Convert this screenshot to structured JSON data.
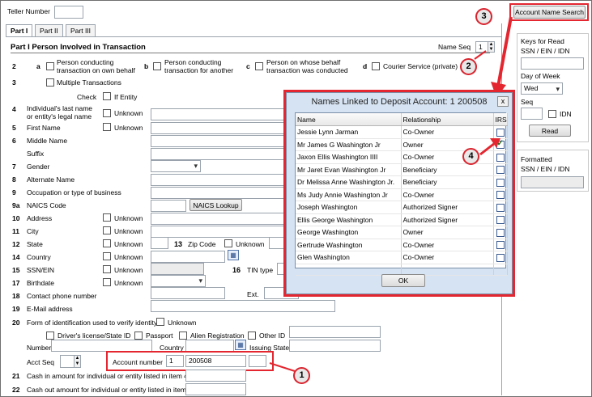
{
  "header": {
    "teller_label": "Teller Number",
    "teller_value": "",
    "tabs": [
      "Part I",
      "Part II",
      "Part III"
    ],
    "account_search_btn": "Account Name Search"
  },
  "section": {
    "title": "Part I Person Involved in Transaction",
    "name_seq_label": "Name Seq",
    "name_seq_value": "1"
  },
  "row2": {
    "num2": "2",
    "a": "a",
    "a_label1": "Person conducting",
    "a_label2": "transaction on own behalf",
    "b": "b",
    "b_label1": "Person conducting",
    "b_label2": "transaction for another",
    "c": "c",
    "c_label1": "Person on whose behalf",
    "c_label2": "transaction was conducted",
    "d": "d",
    "d_label": "Courier Service (private)",
    "num3": "3",
    "multi_label": "Multiple Transactions"
  },
  "form": {
    "check_label": "Check",
    "if_entity": "If Entity",
    "unknown": "Unknown",
    "rows": [
      {
        "num": "4",
        "label1": "Individual's last name",
        "label2": "or entity's legal name"
      },
      {
        "num": "5",
        "label1": "First Name"
      },
      {
        "num": "6",
        "label1": "Middle Name"
      },
      {
        "num": "",
        "label1": "Suffix"
      },
      {
        "num": "7",
        "label1": "Gender"
      },
      {
        "num": "8",
        "label1": "Alternate Name"
      },
      {
        "num": "9",
        "label1": "Occupation or type of business"
      },
      {
        "num": "9a",
        "label1": "NAICS Code"
      },
      {
        "num": "10",
        "label1": "Address"
      },
      {
        "num": "11",
        "label1": "City"
      },
      {
        "num": "12",
        "label1": "State"
      },
      {
        "num": "14",
        "label1": "Country"
      },
      {
        "num": "15",
        "label1": "SSN/EIN"
      },
      {
        "num": "17",
        "label1": "Birthdate"
      },
      {
        "num": "18",
        "label1": "Contact phone number"
      },
      {
        "num": "19",
        "label1": "E-Mail address"
      }
    ],
    "naics_btn": "NAICS Lookup",
    "num13": "13",
    "zip_label": "Zip Code",
    "num16": "16",
    "tin_label": "TIN type",
    "ext_label": "Ext.",
    "num20": "20",
    "id_form_label": "Form of identification used to verify identity",
    "drivers_label": "Driver's license/State ID",
    "passport_label": "Passport",
    "alien_label": "Alien Registration",
    "other_label": "Other ID",
    "number_label": "Number",
    "country_label": "Country",
    "issuing_label": "Issuing State",
    "acct_seq_label": "Acct Seq",
    "account_number_label": "Account number",
    "account_prefix": "1",
    "account_value": "200508",
    "num21": "21",
    "cash_in_label": "Cash in amount for individual or entity listed in item 4",
    "num22": "22",
    "cash_out_label": "Cash out amount for individual or entity listed in item 4"
  },
  "side": {
    "keys_title": "Keys for Read",
    "keys_sub": "SSN / EIN / IDN",
    "dow_label": "Day of Week",
    "dow_value": "Wed",
    "seq_label": "Seq",
    "idn_label": "IDN",
    "read_btn": "Read",
    "formatted_title": "Formatted",
    "formatted_sub": "SSN / EIN / IDN"
  },
  "dialog": {
    "title": "Names Linked to Deposit Account: 1 200508",
    "close": "x",
    "columns": [
      "Name",
      "Relationship",
      "IRS"
    ],
    "rows": [
      {
        "name": "Jessie Lynn Jarman",
        "relationship": "Co-Owner",
        "irs": false
      },
      {
        "name": "Mr James G Washington Jr",
        "relationship": "Owner",
        "irs": true
      },
      {
        "name": "Jaxon Ellis Washington IIII",
        "relationship": "Co-Owner",
        "irs": false
      },
      {
        "name": "Mr Jaret Evan Washington Jr",
        "relationship": "Beneficiary",
        "irs": false
      },
      {
        "name": "Dr Melissa Anne Washington Jr.",
        "relationship": "Beneficiary",
        "irs": false
      },
      {
        "name": "Ms Judy Annie Washington Jr",
        "relationship": "Co-Owner",
        "irs": false
      },
      {
        "name": "Joseph Washington",
        "relationship": "Authorized Signer",
        "irs": false
      },
      {
        "name": "Ellis George Washington",
        "relationship": "Authorized Signer",
        "irs": false
      },
      {
        "name": "George Washington",
        "relationship": "Owner",
        "irs": false
      },
      {
        "name": "Gertrude Washington",
        "relationship": "Co-Owner",
        "irs": false
      },
      {
        "name": "Glen Washington",
        "relationship": "Co-Owner",
        "irs": false
      }
    ],
    "ok_btn": "OK"
  },
  "callouts": [
    "1",
    "2",
    "3",
    "4"
  ],
  "colors": {
    "accent_red": "#e3262f",
    "dialog_bg": "#d6e3f2"
  }
}
